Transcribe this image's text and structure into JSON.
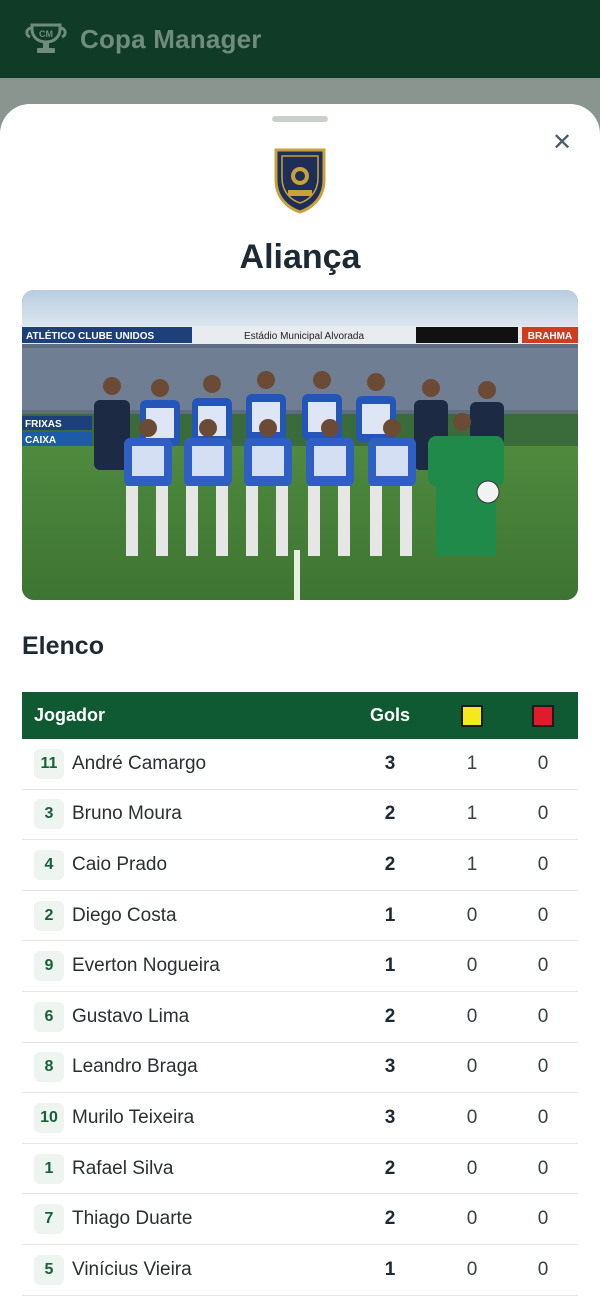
{
  "app": {
    "title": "Copa Manager",
    "logo_icon": "trophy-icon"
  },
  "modal": {
    "close_icon": "close-icon",
    "team_name": "Aliança",
    "crest_icon": "club-crest-icon",
    "photo": {
      "banner_left": "ATLÉTICO CLUBE UNIDOS",
      "banner_center": "Estádio Municipal Alvorada",
      "banner_right": "BRAHMA",
      "ad_left": "CAIXA",
      "ad_left_2": "FRIXAS"
    }
  },
  "roster": {
    "section_title": "Elenco",
    "headers": {
      "player": "Jogador",
      "goals": "Gols"
    },
    "colors": {
      "header_bg": "#0f5a33",
      "yellow_card": "#f5e81b",
      "red_card": "#e11b2b"
    },
    "rows": [
      {
        "number": "11",
        "name": "André Camargo",
        "goals": "3",
        "yellow": "1",
        "red": "0"
      },
      {
        "number": "3",
        "name": "Bruno Moura",
        "goals": "2",
        "yellow": "1",
        "red": "0"
      },
      {
        "number": "4",
        "name": "Caio Prado",
        "goals": "2",
        "yellow": "1",
        "red": "0"
      },
      {
        "number": "2",
        "name": "Diego Costa",
        "goals": "1",
        "yellow": "0",
        "red": "0"
      },
      {
        "number": "9",
        "name": "Everton Nogueira",
        "goals": "1",
        "yellow": "0",
        "red": "0"
      },
      {
        "number": "6",
        "name": "Gustavo Lima",
        "goals": "2",
        "yellow": "0",
        "red": "0"
      },
      {
        "number": "8",
        "name": "Leandro Braga",
        "goals": "3",
        "yellow": "0",
        "red": "0"
      },
      {
        "number": "10",
        "name": "Murilo Teixeira",
        "goals": "3",
        "yellow": "0",
        "red": "0"
      },
      {
        "number": "1",
        "name": "Rafael Silva",
        "goals": "2",
        "yellow": "0",
        "red": "0"
      },
      {
        "number": "7",
        "name": "Thiago Duarte",
        "goals": "2",
        "yellow": "0",
        "red": "0"
      },
      {
        "number": "5",
        "name": "Vinícius Vieira",
        "goals": "1",
        "yellow": "0",
        "red": "0"
      }
    ]
  }
}
